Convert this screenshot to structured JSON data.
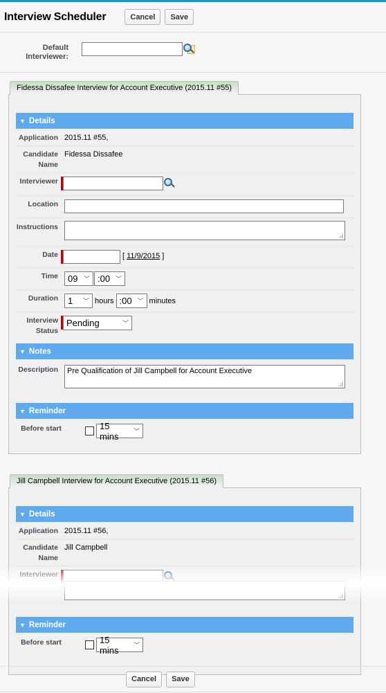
{
  "header": {
    "title": "Interview Scheduler",
    "cancel_label": "Cancel",
    "save_label": "Save"
  },
  "default_interviewer": {
    "label": "Default Interviewer:",
    "value": "",
    "lookup_icon": "lookup-magnifier-icon"
  },
  "colors": {
    "top_bar": "#1797c0",
    "section_header": "#5faaee",
    "required": "#cc0000",
    "tab_gradient_top": "#c6dfc4"
  },
  "interviews": [
    {
      "tab_label": "Fidessa Dissafee Interview for Account Executive (2015.11 #55)",
      "details_header": "Details",
      "application_label": "Application",
      "application_value": "2015.11 #55,",
      "candidate_label": "Candidate Name",
      "candidate_value": "Fidessa Dissafee",
      "interviewer_label": "Interviewer",
      "interviewer_value": "",
      "location_label": "Location",
      "location_value": "",
      "instructions_label": "Instructions",
      "instructions_value": "",
      "date_label": "Date",
      "date_value": "",
      "date_today_link": "11/9/2015",
      "time_label": "Time",
      "time_hour": "09",
      "time_minute": ":00",
      "duration_label": "Duration",
      "duration_hours": "1",
      "hours_text": "hours",
      "duration_minutes": ":00",
      "minutes_text": "minutes",
      "status_label": "Interview Status",
      "status_value": "Pending",
      "notes_header": "Notes",
      "description_label": "Description",
      "description_value": "Pre Qualification of Jill Campbell for Account Executive",
      "reminder_header": "Reminder",
      "before_start_label": "Before start",
      "reminder_checked": false,
      "reminder_value": "15 mins"
    },
    {
      "tab_label": "Jill Campbell Interview  for Account Executive (2015.11 #56)",
      "details_header": "Details",
      "application_label": "Application",
      "application_value": "2015.11 #56,",
      "candidate_label": "Candidate Name",
      "candidate_value": "Jill Campbell",
      "interviewer_label": "Interviewer",
      "interviewer_value": "",
      "reminder_header": "Reminder",
      "before_start_label": "Before start",
      "reminder_checked": false,
      "reminder_value": "15 mins"
    }
  ],
  "footer": {
    "cancel_label": "Cancel",
    "save_label": "Save"
  }
}
